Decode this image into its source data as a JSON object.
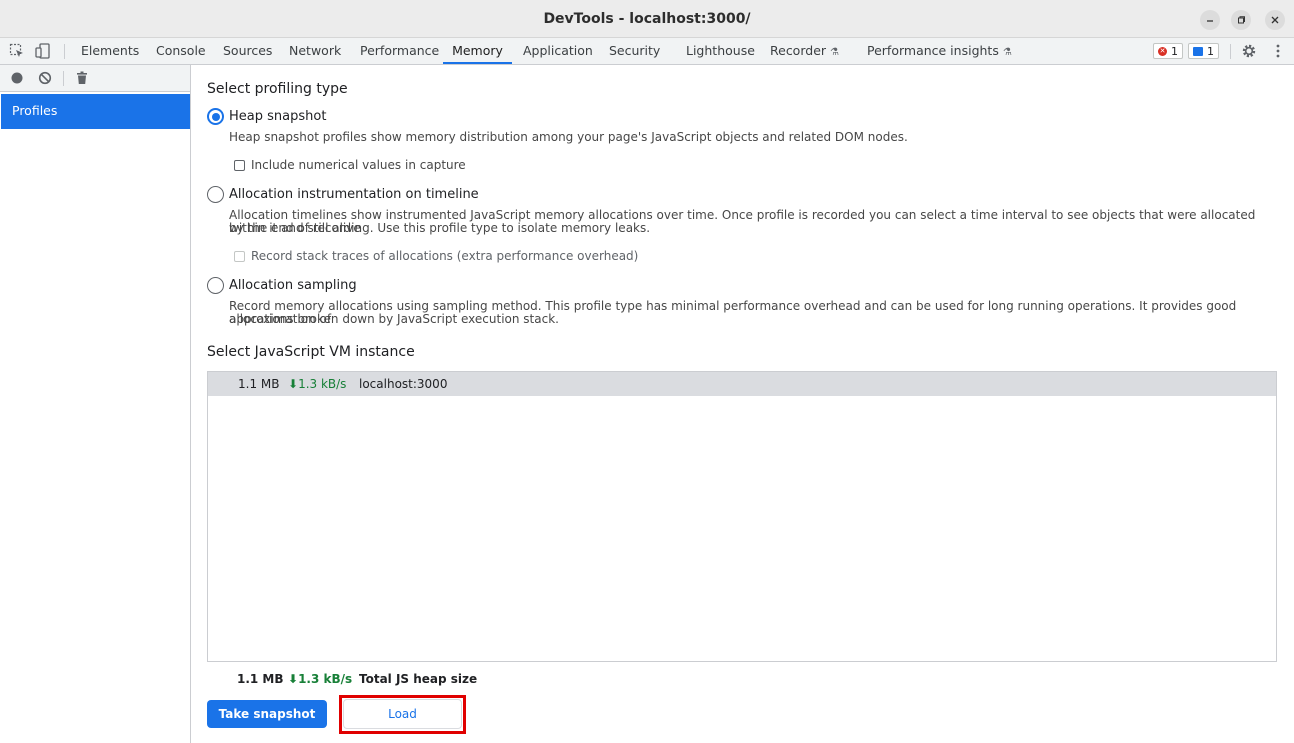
{
  "window": {
    "title": "DevTools - localhost:3000/"
  },
  "tabs": [
    "Elements",
    "Console",
    "Sources",
    "Network",
    "Performance",
    "Memory",
    "Application",
    "Security",
    "Lighthouse",
    "Recorder",
    "Performance insights"
  ],
  "active_tab": "Memory",
  "badges": {
    "errors": "1",
    "messages": "1"
  },
  "sidebar": {
    "profiles_label": "Profiles"
  },
  "main": {
    "profiling_heading": "Select profiling type",
    "options": [
      {
        "label": "Heap snapshot",
        "checked": true,
        "description": "Heap snapshot profiles show memory distribution among your page's JavaScript objects and related DOM nodes.",
        "checkbox": "Include numerical values in capture"
      },
      {
        "label": "Allocation instrumentation on timeline",
        "checked": false,
        "description_line1": "Allocation timelines show instrumented JavaScript memory allocations over time. Once profile is recorded you can select a time interval to see objects that were allocated within it and still alive",
        "description_line2": "by the end of recording. Use this profile type to isolate memory leaks.",
        "checkbox": "Record stack traces of allocations (extra performance overhead)"
      },
      {
        "label": "Allocation sampling",
        "checked": false,
        "description_line1": "Record memory allocations using sampling method. This profile type has minimal performance overhead and can be used for long running operations. It provides good approximation of",
        "description_line2": "allocations broken down by JavaScript execution stack."
      }
    ],
    "vm_heading": "Select JavaScript VM instance",
    "vm_rows": [
      {
        "size": "1.1 MB",
        "rate": "1.3 kB/s",
        "name": "localhost:3000"
      }
    ],
    "summary": {
      "size": "1.1 MB",
      "rate": "1.3 kB/s",
      "label": "Total JS heap size"
    },
    "buttons": {
      "take_snapshot": "Take snapshot",
      "load": "Load"
    }
  },
  "colors": {
    "accent": "#1a73e8",
    "highlight": "#e00000",
    "rate_green": "#188038"
  }
}
